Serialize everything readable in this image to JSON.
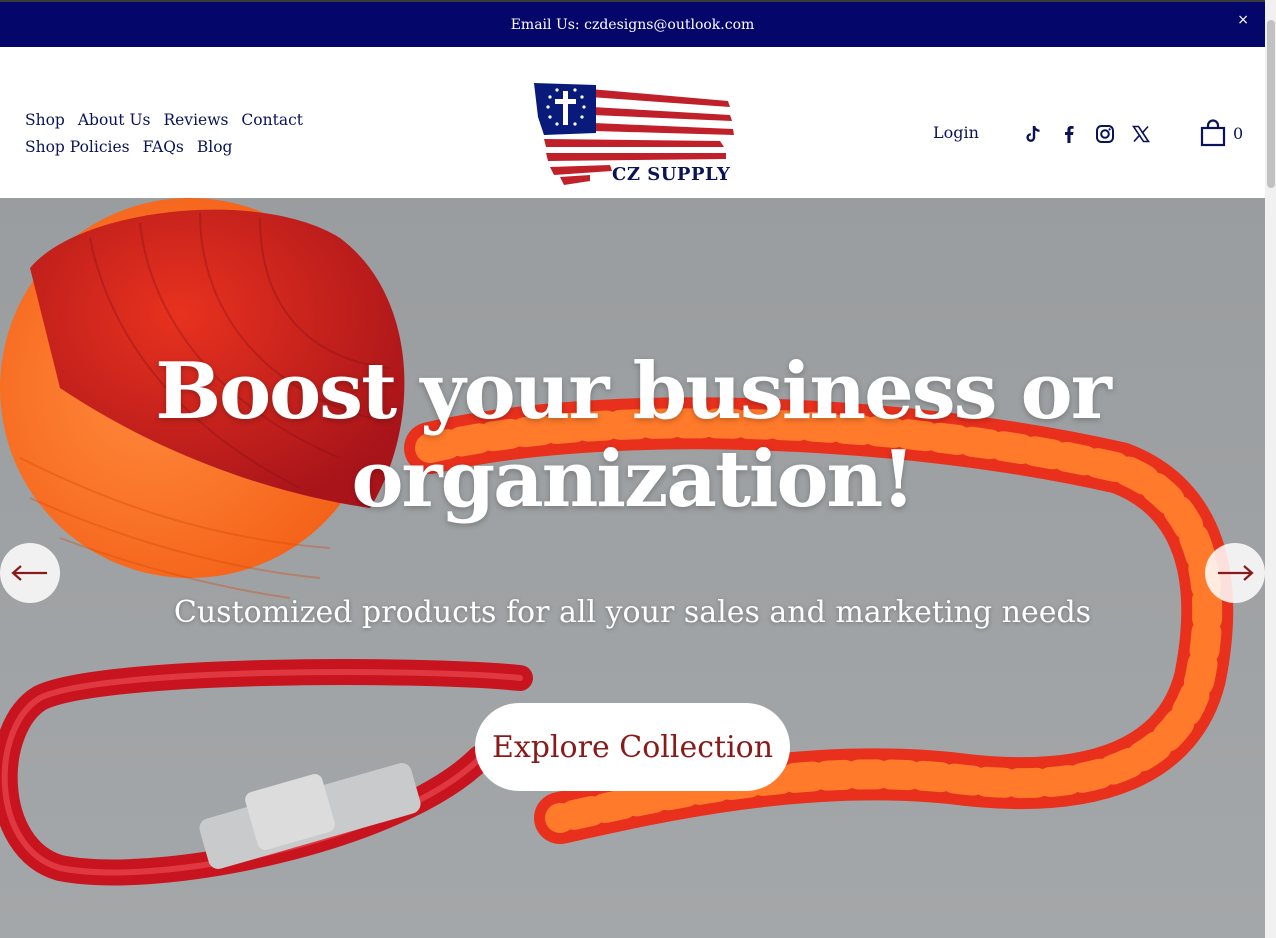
{
  "announcement": {
    "text": "Email Us: czdesigns@outlook.com",
    "close_label": "×"
  },
  "nav": {
    "items": [
      {
        "label": "Shop"
      },
      {
        "label": "About Us"
      },
      {
        "label": "Reviews"
      },
      {
        "label": "Contact"
      },
      {
        "label": "Shop Policies"
      },
      {
        "label": "FAQs"
      },
      {
        "label": "Blog"
      }
    ]
  },
  "logo": {
    "text": "CZ SUPPLY"
  },
  "header": {
    "login_label": "Login",
    "social_icons": [
      "tiktok-icon",
      "facebook-icon",
      "instagram-icon",
      "x-icon"
    ],
    "cart_count": "0"
  },
  "hero": {
    "title": "Boost your business or organization!",
    "subtitle": "Customized products for all your sales and marketing needs",
    "cta_label": "Explore Collection"
  },
  "colors": {
    "announcement_bg": "#05066a",
    "text_primary": "#0a1357",
    "cta_text": "#8a1a1a",
    "flag_red": "#c0202a",
    "flag_blue": "#0a1a7a"
  }
}
